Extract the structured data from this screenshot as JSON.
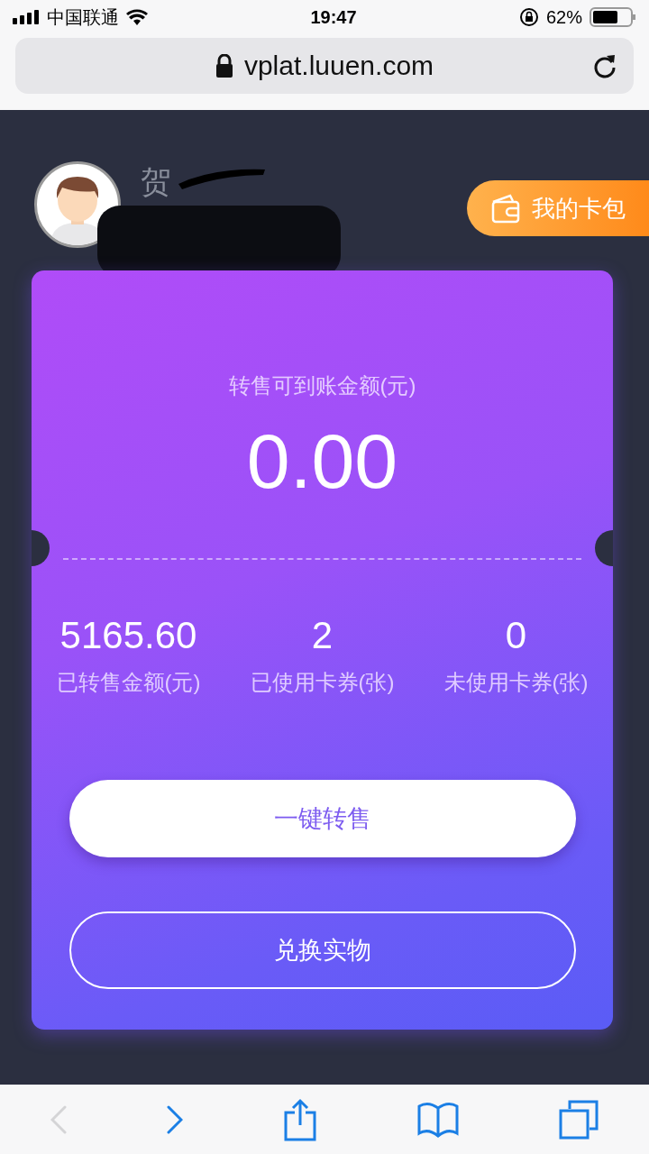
{
  "status_bar": {
    "carrier": "中国联通",
    "time": "19:47",
    "battery": "62%"
  },
  "browser": {
    "url": "vplat.luuen.com"
  },
  "profile": {
    "name": "贺"
  },
  "wallet_button": "我的卡包",
  "card": {
    "title": "转售可到账金额(元)",
    "amount": "0.00",
    "stats": [
      {
        "value": "5165.60",
        "label": "已转售金额(元)"
      },
      {
        "value": "2",
        "label": "已使用卡券(张)"
      },
      {
        "value": "0",
        "label": "未使用卡券(张)"
      }
    ],
    "buttons": [
      {
        "label": "一键转售",
        "kind": "primary"
      },
      {
        "label": "兑换实物",
        "kind": "outline"
      }
    ]
  },
  "toolbar": {
    "back_disabled": true,
    "forward_disabled": false
  }
}
